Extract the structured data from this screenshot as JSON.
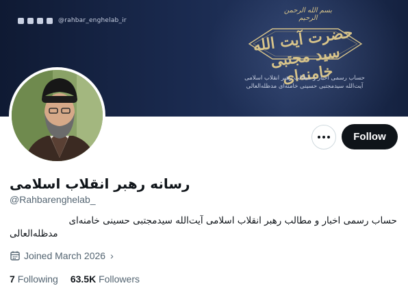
{
  "banner": {
    "social_handle": "@rahbar_enghelab_ir",
    "basmala": "بسم الله الرحمن الرحيم",
    "calligraphy": "حضرت آیت الله سید مجتبی خامنه‌ای",
    "desc_line1": "حساب رسمی اخبار و مطالب رهبر انقلاب اسلامی",
    "desc_line2": "آیت‌الله سیدمجتبی حسینی خامنه‌ای مدظله‌العالی",
    "social_icons": [
      "instagram-icon",
      "telegram-icon",
      "eitaa-icon",
      "web-icon"
    ]
  },
  "profile": {
    "display_name": "رسانه رهبر انقلاب اسلامی",
    "username": "@Rahbarenghelab_",
    "bio_line1": "حساب رسمی اخبار و مطالب رهبر انقلاب اسلامی آیت‌الله سیدمجتبی حسینی خامنه‌ای",
    "bio_line2": "مدظله‌العالی",
    "joined": "Joined March 2026"
  },
  "actions": {
    "follow_label": "Follow"
  },
  "stats": {
    "following_count": "7",
    "following_label": "Following",
    "followers_count": "63.5K",
    "followers_label": "Followers"
  }
}
